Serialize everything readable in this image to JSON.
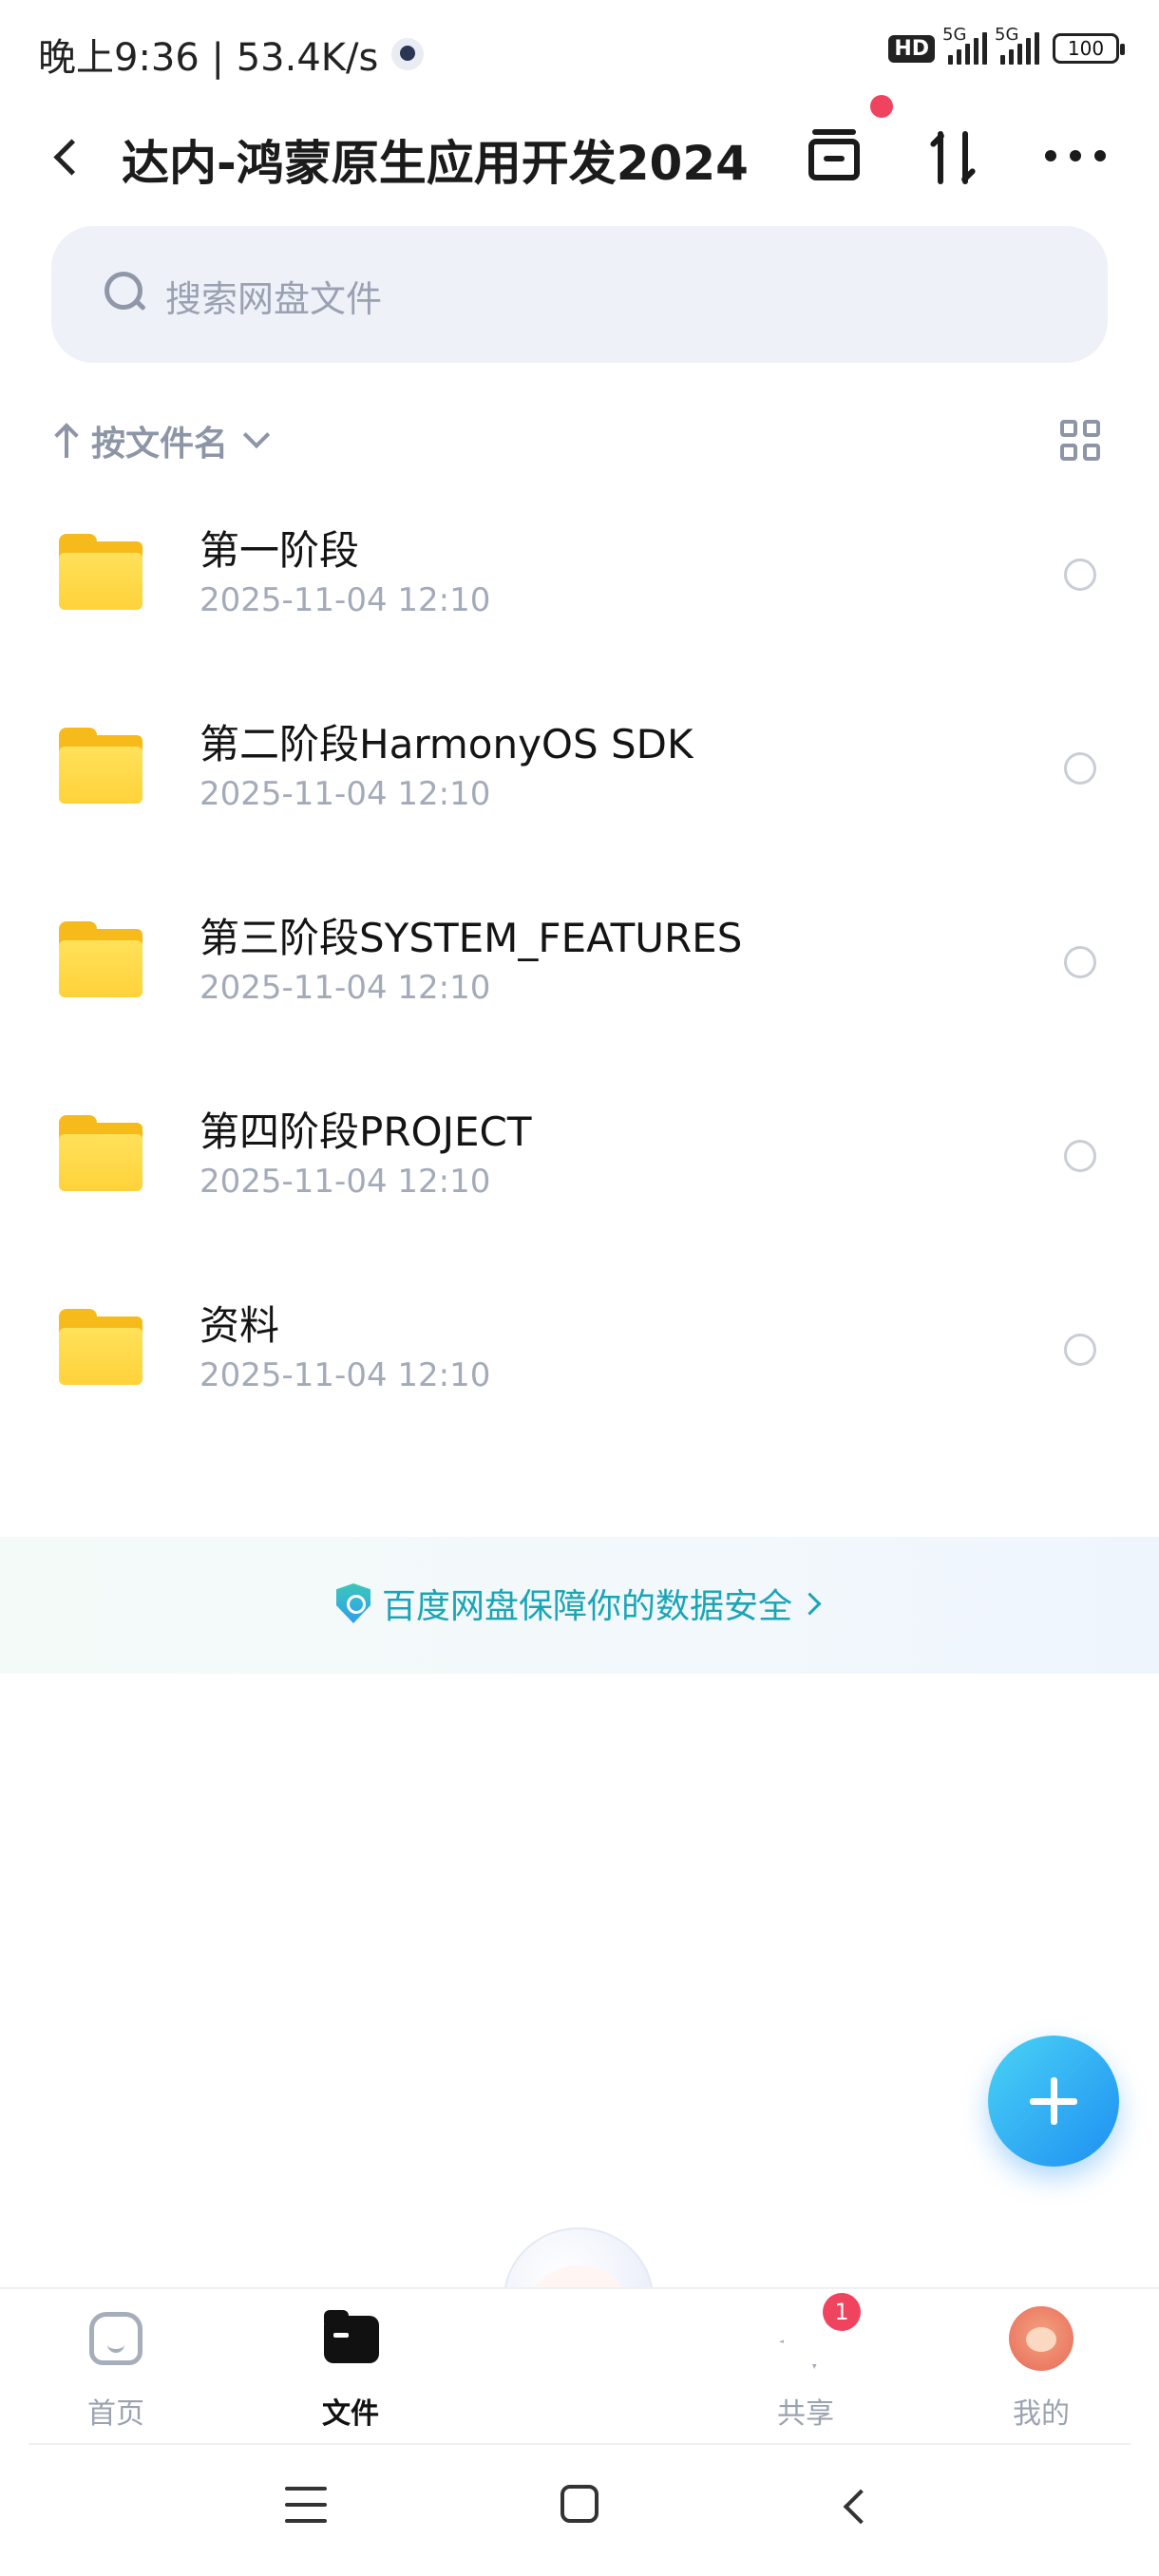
{
  "status_bar": {
    "time_speed": "晚上9:36 | 53.4K/s",
    "hd": "HD",
    "sim1": "5G",
    "sim2": "5G",
    "battery": "100"
  },
  "header": {
    "title": "达内-鸿蒙原生应用开发2024"
  },
  "search": {
    "placeholder": "搜索网盘文件"
  },
  "sort": {
    "label": "按文件名"
  },
  "files": [
    {
      "name": "第一阶段",
      "date": "2025-11-04  12:10"
    },
    {
      "name": "第二阶段HarmonyOS SDK",
      "date": "2025-11-04  12:10"
    },
    {
      "name": "第三阶段SYSTEM_FEATURES",
      "date": "2025-11-04  12:10"
    },
    {
      "name": "第四阶段PROJECT",
      "date": "2025-11-04  12:10"
    },
    {
      "name": "资料",
      "date": "2025-11-04  12:10"
    }
  ],
  "security_banner": {
    "text": "百度网盘保障你的数据安全"
  },
  "bottom_nav": {
    "home": "首页",
    "files": "文件",
    "share": "共享",
    "share_badge": "1",
    "me": "我的"
  },
  "colors": {
    "accent": "#1e8ff2",
    "folder": "#ffd23a",
    "badge": "#f0435f",
    "security_text": "#1aa5b5"
  }
}
